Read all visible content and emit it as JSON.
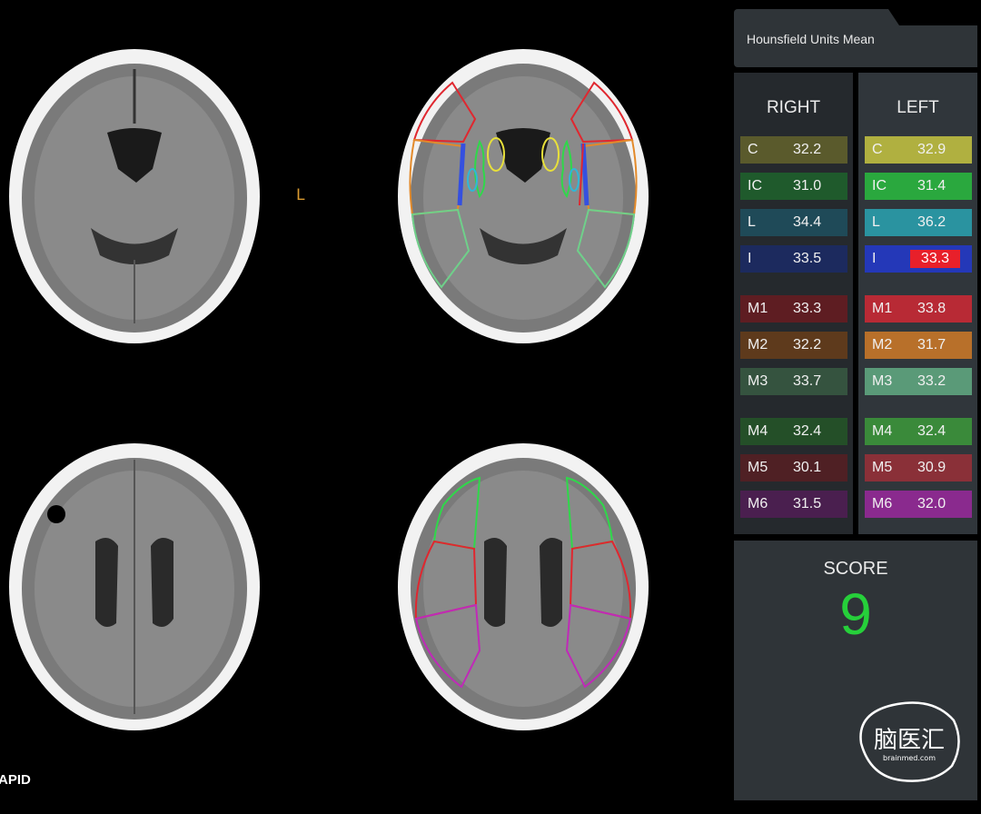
{
  "viewer": {
    "orientation_marker": "L",
    "brand": "APID"
  },
  "panel": {
    "title": "Hounsfield Units Mean",
    "right_header": "RIGHT",
    "left_header": "LEFT",
    "right": [
      {
        "region": "C",
        "value": "32.2",
        "color": "#5a5a2c"
      },
      {
        "region": "IC",
        "value": "31.0",
        "color": "#1f5a2c"
      },
      {
        "region": "L",
        "value": "34.4",
        "color": "#1f4a58"
      },
      {
        "region": "I",
        "value": "33.5",
        "color": "#1c2a5e"
      },
      {
        "region": "M1",
        "value": "33.3",
        "color": "#5e1d22"
      },
      {
        "region": "M2",
        "value": "32.2",
        "color": "#5e3a1c"
      },
      {
        "region": "M3",
        "value": "33.7",
        "color": "#35533f"
      },
      {
        "region": "M4",
        "value": "32.4",
        "color": "#244f28"
      },
      {
        "region": "M5",
        "value": "30.1",
        "color": "#4f2024"
      },
      {
        "region": "M6",
        "value": "31.5",
        "color": "#4a1f4f"
      }
    ],
    "left": [
      {
        "region": "C",
        "value": "32.9",
        "color": "#b0b040",
        "alert": false
      },
      {
        "region": "IC",
        "value": "31.4",
        "color": "#2aa83e",
        "alert": false
      },
      {
        "region": "L",
        "value": "36.2",
        "color": "#2a93a0",
        "alert": false
      },
      {
        "region": "I",
        "value": "33.3",
        "color": "#2438b8",
        "alert": true
      },
      {
        "region": "M1",
        "value": "33.8",
        "color": "#b82a35",
        "alert": false
      },
      {
        "region": "M2",
        "value": "31.7",
        "color": "#b8702a",
        "alert": false
      },
      {
        "region": "M3",
        "value": "33.2",
        "color": "#5a9a78",
        "alert": false
      },
      {
        "region": "M4",
        "value": "32.4",
        "color": "#3a8a3a",
        "alert": false
      },
      {
        "region": "M5",
        "value": "30.9",
        "color": "#8a3038",
        "alert": false
      },
      {
        "region": "M6",
        "value": "32.0",
        "color": "#8a2a8e",
        "alert": false
      }
    ],
    "score_label": "SCORE",
    "score_value": "9",
    "score_color": "#26d03a",
    "logo_text": "脑医汇",
    "logo_subtext": "brainmed.com"
  }
}
